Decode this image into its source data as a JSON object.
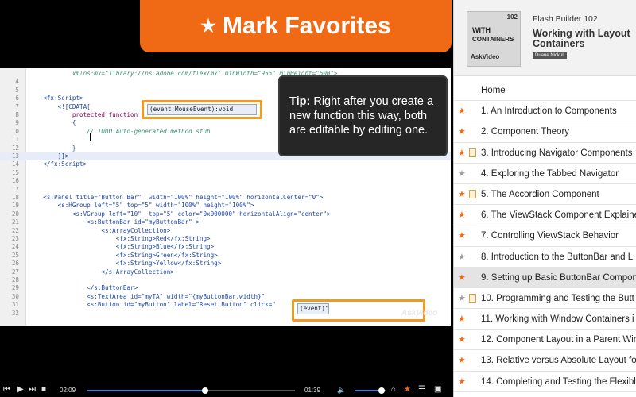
{
  "banner": {
    "star": "★",
    "label": "Mark Favorites"
  },
  "tip": {
    "prefix": "Tip:",
    "text": " Right after you create a new function this way, both are editable by editing one."
  },
  "watermark": "AskVideo",
  "code": {
    "lines": [
      {
        "n": "",
        "text": "            xmlns:mx=\"library://ns.adobe.com/flex/mx\" minWidth=\"955\" minHeight=\"600\">"
      },
      {
        "n": "4",
        "text": ""
      },
      {
        "n": "5",
        "text": ""
      },
      {
        "n": "6",
        "text": "    <fx:Script>"
      },
      {
        "n": "7",
        "text": "        <![CDATA["
      },
      {
        "n": "8",
        "text": "            protected function"
      },
      {
        "n": "9",
        "text": "            {"
      },
      {
        "n": "10",
        "text": "                // TODO Auto-generated method stub"
      },
      {
        "n": "11",
        "text": ""
      },
      {
        "n": "12",
        "text": "            }"
      },
      {
        "n": "13",
        "text": "        ]]>"
      },
      {
        "n": "14",
        "text": "    </fx:Script>"
      },
      {
        "n": "15",
        "text": ""
      },
      {
        "n": "16",
        "text": ""
      },
      {
        "n": "17",
        "text": ""
      },
      {
        "n": "18",
        "text": "    <s:Panel title=\"Button Bar\"  width=\"100%\" height=\"100%\" horizontalCenter=\"0\">"
      },
      {
        "n": "19",
        "text": "        <s:HGroup left=\"5\" top=\"5\" width=\"100%\" height=\"100%\">"
      },
      {
        "n": "20",
        "text": "            <s:VGroup left=\"10\"  top=\"5\" color=\"0x000000\" horizontalAlign=\"center\">"
      },
      {
        "n": "21",
        "text": "                <s:ButtonBar id=\"myButtonBar\" >"
      },
      {
        "n": "22",
        "text": "                    <s:ArrayCollection>"
      },
      {
        "n": "23",
        "text": "                        <fx:String>Red</fx:String>"
      },
      {
        "n": "24",
        "text": "                        <fx:String>Blue</fx:String>"
      },
      {
        "n": "25",
        "text": "                        <fx:String>Green</fx:String>"
      },
      {
        "n": "26",
        "text": "                        <fx:String>Yellow</fx:String>"
      },
      {
        "n": "27",
        "text": "                    </s:ArrayCollection>"
      },
      {
        "n": "28",
        "text": ""
      },
      {
        "n": "29",
        "text": "                </s:ButtonBar>"
      },
      {
        "n": "30",
        "text": "                <s:TextArea id=\"myTA\" width=\"{myButtonBar.width}\""
      },
      {
        "n": "31",
        "text": "                <s:Button id=\"myButton\" label=\"Reset Button\" click=\""
      },
      {
        "n": "32",
        "text": ""
      }
    ],
    "highlight1": "(event:MouseEvent):void",
    "highlight2": "(event)\""
  },
  "controls": {
    "elapsed": "02:09",
    "remaining": "01:39",
    "progress_fraction": 0.57,
    "volume_fraction": 0.85
  },
  "course": {
    "thumb_number": "102",
    "thumb_word1": "WITH",
    "thumb_word2": "CONTAINERS",
    "thumb_brand": "AskVideo",
    "series": "Flash Builder 102",
    "title": "Working with Layout Containers",
    "author": "Duane Nickull"
  },
  "lessons": [
    {
      "label": "Home",
      "star": "",
      "doc": false
    },
    {
      "label": "1. An Introduction to Components",
      "star": "on",
      "doc": false
    },
    {
      "label": "2. Component Theory",
      "star": "on",
      "doc": false
    },
    {
      "label": "3. Introducing Navigator Components",
      "star": "on",
      "doc": true
    },
    {
      "label": "4. Exploring the Tabbed Navigator",
      "star": "off",
      "doc": false
    },
    {
      "label": "5. The Accordion Component",
      "star": "on",
      "doc": true
    },
    {
      "label": "6. The ViewStack Component Explained",
      "star": "on",
      "doc": false
    },
    {
      "label": "7. Controlling ViewStack Behavior",
      "star": "on",
      "doc": false
    },
    {
      "label": "8. Introduction to the ButtonBar and L",
      "star": "off",
      "doc": false
    },
    {
      "label": "9. Setting up Basic ButtonBar Compon",
      "star": "on",
      "doc": false,
      "active": true
    },
    {
      "label": "10. Programming and Testing the Butt",
      "star": "off",
      "doc": true
    },
    {
      "label": "11. Working with Window Containers i",
      "star": "on",
      "doc": false
    },
    {
      "label": "12. Component Layout in a Parent Win",
      "star": "on",
      "doc": false
    },
    {
      "label": "13. Relative versus Absolute Layout fo",
      "star": "on",
      "doc": false
    },
    {
      "label": "14. Completing and Testing the Flexibl",
      "star": "on",
      "doc": false
    }
  ]
}
